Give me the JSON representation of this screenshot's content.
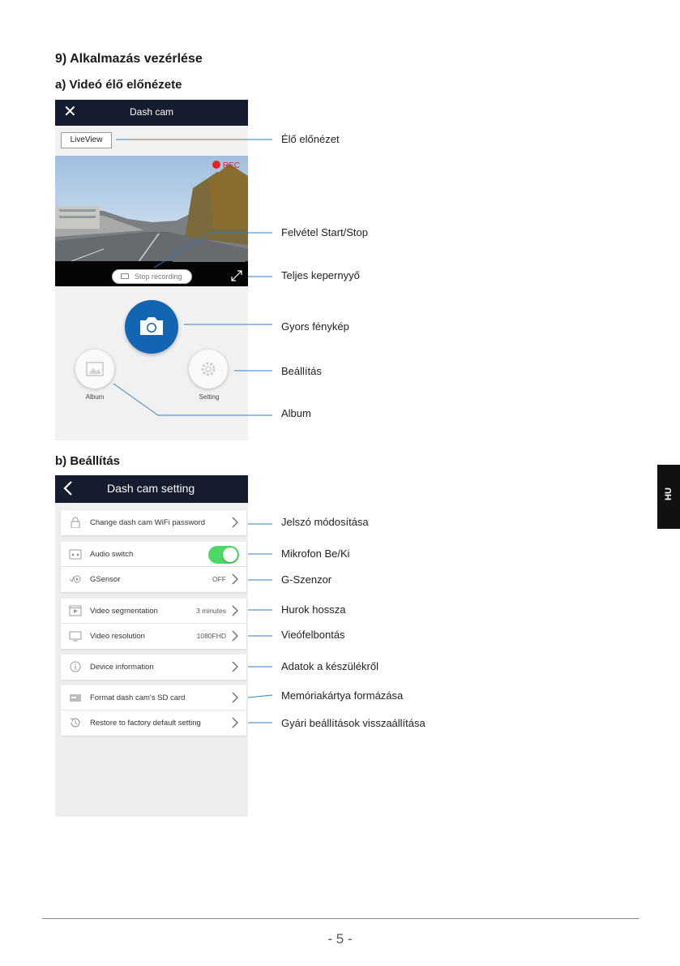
{
  "section_title": "9) Alkalmazás vezérlése",
  "sub_a": "a) Videó élő előnézete",
  "sub_b": "b) Beállítás",
  "screen_a": {
    "title": "Dash cam",
    "liveview": "LiveView",
    "rec": "REC",
    "stop_recording": "Stop recording",
    "album": "Album",
    "setting": "Setting"
  },
  "callouts_a": [
    "Élő előnézet",
    "Felvétel Start/Stop",
    "Teljes kepernyyő",
    "Gyors fénykép",
    "Beállítás",
    "Album"
  ],
  "screen_b": {
    "title": "Dash cam setting",
    "rows": [
      {
        "label": "Change dash cam WiFi password",
        "value": ""
      },
      {
        "label": "Audio switch",
        "value": ""
      },
      {
        "label": "GSensor",
        "value": "OFF"
      },
      {
        "label": "Video segmentation",
        "value": "3 minutes"
      },
      {
        "label": "Video resolution",
        "value": "1080FHD"
      },
      {
        "label": "Device information",
        "value": ""
      },
      {
        "label": "Format dash cam's SD card",
        "value": ""
      },
      {
        "label": "Restore to factory default setting",
        "value": ""
      }
    ]
  },
  "callouts_b": [
    "Jelszó módosítása",
    "Mikrofon Be/Ki",
    "G-Szenzor",
    "Hurok hossza",
    "Vieófelbontás",
    "Adatok a készülékről",
    "Memóriakártya formázása",
    "Gyári beállítások visszaállítása"
  ],
  "lang_tab": "HU",
  "page_number": "- 5 -",
  "colors": {
    "accent": "#1464b4",
    "topbar": "#151c2e",
    "toggle_on": "#4cd964",
    "rec": "#e0242a",
    "callout_line": "#2f7fc8"
  }
}
